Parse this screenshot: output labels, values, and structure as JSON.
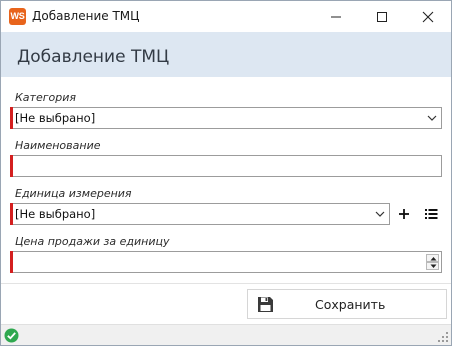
{
  "window": {
    "app_icon_text": "WS",
    "title": "Добавление ТМЦ",
    "icons": {
      "minimize": "minimize-icon",
      "maximize": "maximize-icon",
      "close": "close-icon"
    }
  },
  "header": {
    "title": "Добавление ТМЦ"
  },
  "form": {
    "category": {
      "label": "Категория",
      "value": "[Не выбрано]"
    },
    "name": {
      "label": "Наименование",
      "value": ""
    },
    "unit": {
      "label": "Единица измерения",
      "value": "[Не выбрано]"
    },
    "price": {
      "label": "Цена продажи за единицу",
      "value": ""
    }
  },
  "actions": {
    "save_label": "Сохранить"
  },
  "colors": {
    "accent_brand": "#e8641c",
    "required_marker": "#d41f1f",
    "header_band": "#dde7f2",
    "status_ok": "#2fa84f"
  }
}
